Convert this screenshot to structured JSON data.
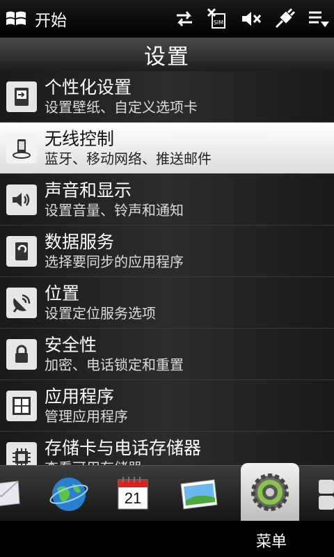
{
  "status_bar": {
    "start_label": "开始",
    "icons": [
      "sync-arrows-icon",
      "no-sim-icon",
      "speaker-muted-icon",
      "usb-plug-icon",
      "menu-lines-icon"
    ]
  },
  "title": "设置",
  "settings": {
    "items": [
      {
        "title": "个性化设置",
        "subtitle": "设置壁纸、自定义选项卡",
        "icon": "personalize-icon"
      },
      {
        "title": "无线控制",
        "subtitle": "蓝牙、移动网络、推送邮件",
        "icon": "phone-wireless-icon",
        "selected": true
      },
      {
        "title": "声音和显示",
        "subtitle": "设置音量、铃声和通知",
        "icon": "speaker-icon"
      },
      {
        "title": "数据服务",
        "subtitle": "选择要同步的应用程序",
        "icon": "sync-phone-icon"
      },
      {
        "title": "位置",
        "subtitle": "设置定位服务选项",
        "icon": "satellite-dish-icon"
      },
      {
        "title": "安全性",
        "subtitle": "加密、电话锁定和重置",
        "icon": "lock-icon"
      },
      {
        "title": "应用程序",
        "subtitle": "管理应用程序",
        "icon": "apps-grid-icon"
      },
      {
        "title": "存储卡与电话存储器",
        "subtitle": "查看可用存储器",
        "icon": "memory-chip-icon"
      }
    ]
  },
  "tabs": {
    "items": [
      "mail-icon",
      "internet-globe-icon",
      "calendar-icon",
      "photos-icon",
      "settings-gear-icon",
      "more-tiles-icon"
    ],
    "calendar_day": "21",
    "active": "settings-gear-icon"
  },
  "menu": {
    "label": "菜单"
  }
}
